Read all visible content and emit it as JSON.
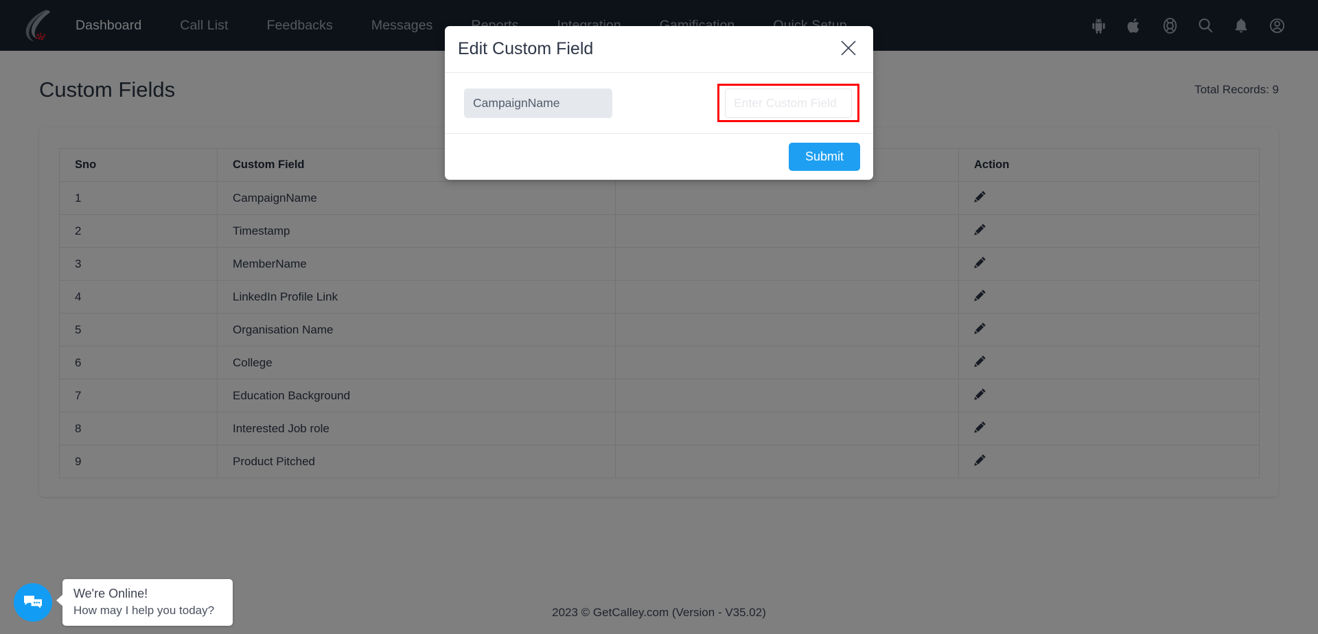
{
  "nav": {
    "logo_name": "calley-logo",
    "links": [
      {
        "label": "Dashboard"
      },
      {
        "label": "Call List"
      },
      {
        "label": "Feedbacks"
      },
      {
        "label": "Messages"
      },
      {
        "label": "Reports"
      },
      {
        "label": "Integration"
      },
      {
        "label": "Gamification"
      },
      {
        "label": "Quick Setup"
      }
    ],
    "icons": [
      {
        "name": "android-icon"
      },
      {
        "name": "apple-icon"
      },
      {
        "name": "lifebuoy-support-icon"
      },
      {
        "name": "search-icon"
      },
      {
        "name": "bell-notification-icon"
      },
      {
        "name": "user-account-icon"
      }
    ]
  },
  "page": {
    "title": "Custom Fields",
    "total_records": "Total Records: 9"
  },
  "table": {
    "headers": [
      "Sno",
      "Custom Field",
      "",
      "Action"
    ],
    "rows": [
      {
        "sno": "1",
        "field": "CampaignName",
        "blank": "",
        "action_icon": "pencil-edit-icon"
      },
      {
        "sno": "2",
        "field": "Timestamp",
        "blank": "",
        "action_icon": "pencil-edit-icon"
      },
      {
        "sno": "3",
        "field": "MemberName",
        "blank": "",
        "action_icon": "pencil-edit-icon"
      },
      {
        "sno": "4",
        "field": "LinkedIn Profile Link",
        "blank": "",
        "action_icon": "pencil-edit-icon"
      },
      {
        "sno": "5",
        "field": "Organisation Name",
        "blank": "",
        "action_icon": "pencil-edit-icon"
      },
      {
        "sno": "6",
        "field": "College",
        "blank": "",
        "action_icon": "pencil-edit-icon"
      },
      {
        "sno": "7",
        "field": "Education Background",
        "blank": "",
        "action_icon": "pencil-edit-icon"
      },
      {
        "sno": "8",
        "field": "Interested Job role",
        "blank": "",
        "action_icon": "pencil-edit-icon"
      },
      {
        "sno": "9",
        "field": "Product Pitched",
        "blank": "",
        "action_icon": "pencil-edit-icon"
      }
    ]
  },
  "modal": {
    "title": "Edit Custom Field",
    "close_icon": "close-x-icon",
    "readonly_value": "CampaignName",
    "input_value": "",
    "input_placeholder": "Enter Custom Field",
    "submit_label": "Submit",
    "highlight_color": "#fe0000"
  },
  "chat": {
    "icon": "chat-bubbles-icon",
    "title": "We're Online!",
    "subtitle": "How may I help you today?",
    "accent_color": "#129cf3"
  },
  "footer": {
    "text": "2023 © GetCalley.com (Version - V35.02)"
  },
  "colors": {
    "nav_background": "#1b2432",
    "accent_blue": "#1e9ff2",
    "text_dark": "#2e3748"
  }
}
